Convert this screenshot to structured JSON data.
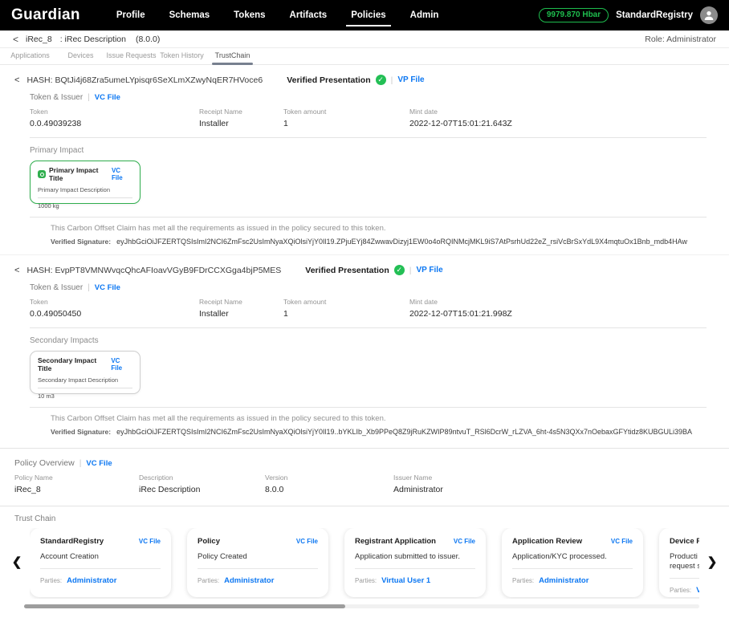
{
  "nav": {
    "brand": "Guardian",
    "items": [
      "Profile",
      "Schemas",
      "Tokens",
      "Artifacts",
      "Policies",
      "Admin"
    ],
    "active_item": "Policies",
    "balance": "9979.870 Hbar",
    "username": "StandardRegistry"
  },
  "breadcrumb": {
    "policy": "iRec_8",
    "description": ": iRec Description",
    "version": "(8.0.0)",
    "role": "Role: Administrator"
  },
  "tabs": {
    "items": [
      "Applications",
      "Devices",
      "Issue Requests",
      "Token History",
      "TrustChain"
    ],
    "active": "TrustChain"
  },
  "labels": {
    "hash_prefix": "HASH:",
    "verified_presentation": "Verified Presentation",
    "vp_file": "VP File",
    "vc_file": "VC File",
    "token_issuer": "Token & Issuer",
    "claim": "This Carbon Offset Claim has met all the requirements as issued in the policy secured to this token.",
    "verified_signature": "Verified Signature:",
    "parties": "Parties:"
  },
  "groups": [
    {
      "hash": "BQtJi4j68Zra5umeLYpisqr6SeXLmXZwyNqER7HVoce6",
      "fields": [
        {
          "label": "Token",
          "value": "0.0.49039238"
        },
        {
          "label": "Receipt Name",
          "value": "Installer"
        },
        {
          "label": "Token amount",
          "value": "1"
        },
        {
          "label": "Mint date",
          "value": "2022-12-07T15:01:21.643Z"
        }
      ],
      "impact": {
        "heading": "Primary Impact",
        "title": "Primary Impact Title",
        "description": "Primary Impact Description",
        "value": "1000 kg"
      },
      "signature": "eyJhbGciOiJFZERTQSIsImI2NCI6ZmFsc2UsImNyaXQiOlsiYjY0Il19.ZPjuEYj84ZwwavDizyj1EW0o4oRQINMcjMKL9iS7AtPsrhUd22eZ_rsiVcBrSxYdL9X4mqtuOx1Bnb_mdb4HAw"
    },
    {
      "hash": "EvpPT8VMNWvqcQhcAFIoavVGyB9FDrCCXGga4bjP5MES",
      "fields": [
        {
          "label": "Token",
          "value": "0.0.49050450"
        },
        {
          "label": "Receipt Name",
          "value": "Installer"
        },
        {
          "label": "Token amount",
          "value": "1"
        },
        {
          "label": "Mint date",
          "value": "2022-12-07T15:01:21.998Z"
        }
      ],
      "impact": {
        "heading": "Secondary Impacts",
        "title": "Secondary Impact Title",
        "description": "Secondary Impact Description",
        "value": "10 m3"
      },
      "signature": "eyJhbGciOiJFZERTQSIsImI2NCI6ZmFsc2UsImNyaXQiOlsiYjY0Il19..bYKLIb_Xb9PPeQ8Z9jRuKZWIP89ntvuT_RSl6DcrW_rLZVA_6ht-4s5N3QXx7nOebaxGFYtidz8KUBGULi39BA"
    }
  ],
  "policy_overview": {
    "heading": "Policy Overview",
    "fields": [
      {
        "label": "Policy Name",
        "value": "iRec_8"
      },
      {
        "label": "Description",
        "value": "iRec Description"
      },
      {
        "label": "Version",
        "value": "8.0.0"
      },
      {
        "label": "Issuer Name",
        "value": "Administrator"
      }
    ]
  },
  "trust_chain": {
    "heading": "Trust Chain",
    "cards": [
      {
        "title": "StandardRegistry",
        "description": "Account Creation",
        "parties": "Administrator"
      },
      {
        "title": "Policy",
        "description": "Policy Created",
        "parties": "Administrator"
      },
      {
        "title": "Registrant Application",
        "description": "Application submitted to issuer.",
        "parties": "Virtual User 1"
      },
      {
        "title": "Application Review",
        "description": "Application/KYC processed.",
        "parties": "Administrator"
      },
      {
        "title": "Device Re",
        "description": "Producti\nrequest s",
        "parties": "V"
      }
    ]
  }
}
